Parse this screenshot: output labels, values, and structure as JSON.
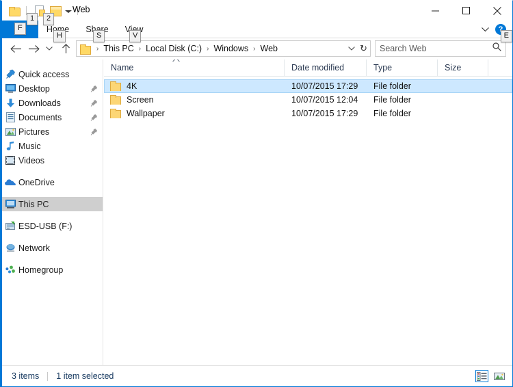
{
  "window": {
    "title": "Web",
    "quick_access_toolbar": [
      {
        "name": "properties",
        "keytip": "1"
      },
      {
        "name": "new-folder",
        "keytip": "2"
      }
    ],
    "qat_customize_keytip": null,
    "controls": {
      "minimize": "–",
      "maximize": "□",
      "close": "✕"
    }
  },
  "ribbon": {
    "file_tab": {
      "label": "File",
      "keytip": "F"
    },
    "tabs": [
      {
        "label": "Home",
        "keytip": "H"
      },
      {
        "label": "Share",
        "keytip": "S"
      },
      {
        "label": "View",
        "keytip": "V"
      }
    ],
    "help": {
      "label": "?",
      "keytip": "E"
    }
  },
  "address": {
    "crumbs": [
      "This PC",
      "Local Disk (C:)",
      "Windows",
      "Web"
    ],
    "separator": "›",
    "refresh_glyph": "↻"
  },
  "search": {
    "placeholder": "Search Web",
    "value": ""
  },
  "sidebar": {
    "items": [
      {
        "label": "Quick access",
        "icon": "pin-star-icon",
        "pinned": false,
        "selected": false
      },
      {
        "label": "Desktop",
        "icon": "desktop-icon",
        "pinned": true,
        "selected": false
      },
      {
        "label": "Downloads",
        "icon": "download-icon",
        "pinned": true,
        "selected": false
      },
      {
        "label": "Documents",
        "icon": "document-icon",
        "pinned": true,
        "selected": false
      },
      {
        "label": "Pictures",
        "icon": "picture-icon",
        "pinned": true,
        "selected": false
      },
      {
        "label": "Music",
        "icon": "music-icon",
        "pinned": false,
        "selected": false
      },
      {
        "label": "Videos",
        "icon": "video-icon",
        "pinned": false,
        "selected": false
      },
      {
        "label": "OneDrive",
        "icon": "cloud-icon",
        "pinned": false,
        "selected": false
      },
      {
        "label": "This PC",
        "icon": "computer-icon",
        "pinned": false,
        "selected": true
      },
      {
        "label": "ESD-USB (F:)",
        "icon": "usb-drive-icon",
        "pinned": false,
        "selected": false
      },
      {
        "label": "Network",
        "icon": "network-icon",
        "pinned": false,
        "selected": false
      },
      {
        "label": "Homegroup",
        "icon": "homegroup-icon",
        "pinned": false,
        "selected": false
      }
    ]
  },
  "filelist": {
    "columns": [
      "Name",
      "Date modified",
      "Type",
      "Size"
    ],
    "sort_column": "Name",
    "sort_direction": "ascending",
    "rows": [
      {
        "name": "4K",
        "date": "10/07/2015 17:29",
        "type": "File folder",
        "size": "",
        "selected": true
      },
      {
        "name": "Screen",
        "date": "10/07/2015 12:04",
        "type": "File folder",
        "size": "",
        "selected": false
      },
      {
        "name": "Wallpaper",
        "date": "10/07/2015 17:29",
        "type": "File folder",
        "size": "",
        "selected": false
      }
    ]
  },
  "status": {
    "item_count": "3 items",
    "selection": "1 item selected",
    "views": [
      {
        "name": "details-view",
        "active": true
      },
      {
        "name": "large-icons-view",
        "active": false
      }
    ]
  },
  "colors": {
    "accent": "#0078d7",
    "selection": "#cde8ff",
    "nav_selection": "#cfcfcf",
    "folder": "#fcd675",
    "status_text": "#14375e"
  }
}
